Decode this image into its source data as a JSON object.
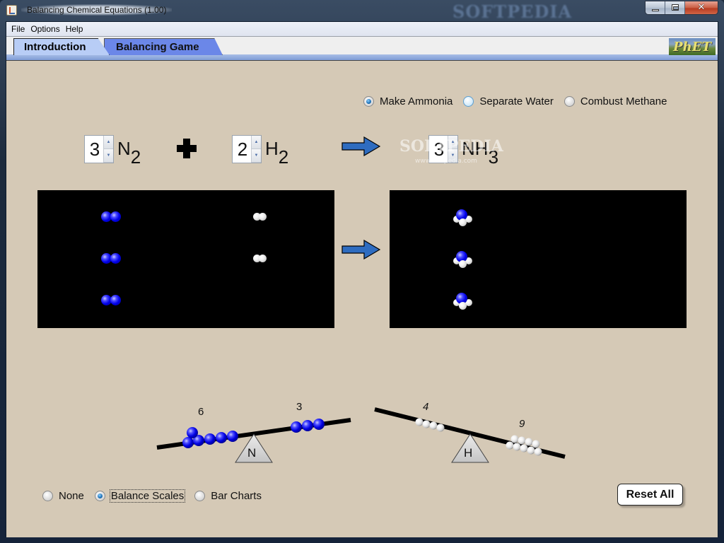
{
  "window": {
    "title": "Balancing Chemical Equations (1.00)",
    "watermark": "SOFTPEDIA",
    "controls": {
      "minimize": "minimize",
      "maximize": "maximize",
      "close": "✕"
    }
  },
  "menu": [
    "File",
    "Options",
    "Help"
  ],
  "tabs": [
    {
      "label": "Introduction",
      "selected": true
    },
    {
      "label": "Balancing Game",
      "selected": false
    }
  ],
  "logo": "PhET",
  "reaction_options": [
    {
      "label": "Make Ammonia",
      "selected": true
    },
    {
      "label": "Separate Water",
      "selected": false
    },
    {
      "label": "Combust Methane",
      "selected": false
    }
  ],
  "equation": {
    "reactants": [
      {
        "coefficient": "3",
        "symbol": "N",
        "subscript": "2"
      },
      {
        "coefficient": "2",
        "symbol": "H",
        "subscript": "2"
      }
    ],
    "plus": "+",
    "products": [
      {
        "coefficient": "3",
        "symbol": "NH",
        "subscript": "3"
      }
    ]
  },
  "molecule_boxes": {
    "reactants": {
      "n2_count": 3,
      "h2_count": 2
    },
    "products": {
      "nh3_count": 3
    }
  },
  "balance_scales": [
    {
      "element": "N",
      "left_count": "6",
      "right_count": "3",
      "tilt": "left-down"
    },
    {
      "element": "H",
      "left_count": "4",
      "right_count": "9",
      "tilt": "right-down"
    }
  ],
  "view_options": [
    {
      "label": "None",
      "selected": false
    },
    {
      "label": "Balance Scales",
      "selected": true
    },
    {
      "label": "Bar Charts",
      "selected": false
    }
  ],
  "reset_button": "Reset All",
  "watermark_overlay": {
    "text": "SOFTPEDIA",
    "url": "www.softpedia.com"
  }
}
